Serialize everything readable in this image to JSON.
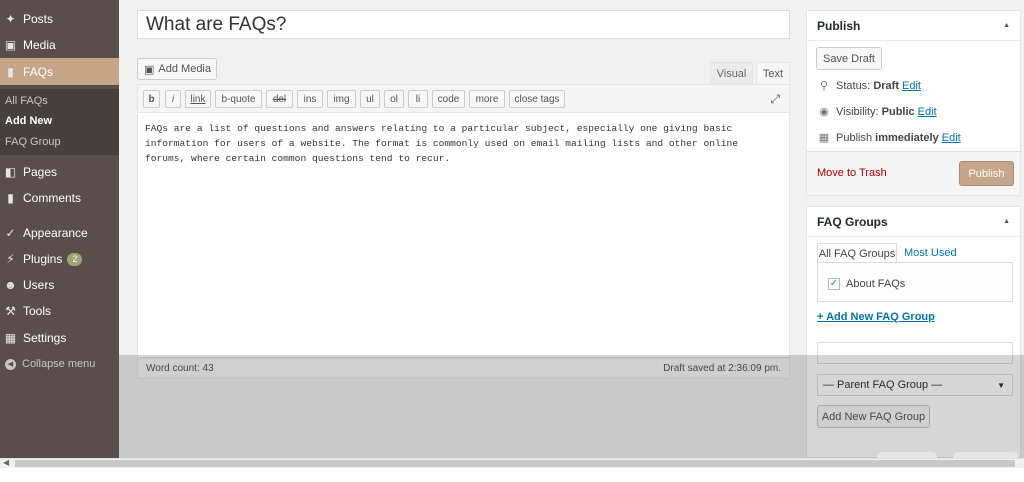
{
  "menu": {
    "posts": "Posts",
    "media": "Media",
    "faqs": "FAQs",
    "submenu": [
      "All FAQs",
      "Add New",
      "FAQ Group"
    ],
    "pages": "Pages",
    "comments": "Comments",
    "appearance": "Appearance",
    "plugins": "Plugins",
    "plugins_badge": "2",
    "users": "Users",
    "tools": "Tools",
    "settings": "Settings",
    "collapse": "Collapse menu"
  },
  "post": {
    "title": "What are FAQs?",
    "add_media": "Add Media",
    "tab_visual": "Visual",
    "tab_text": "Text",
    "quicktags": [
      "b",
      "i",
      "link",
      "b-quote",
      "del",
      "ins",
      "img",
      "ul",
      "ol",
      "li",
      "code",
      "more",
      "close tags"
    ],
    "content": "FAQs are a list of questions and answers relating to a particular subject, especially one giving basic information for users of a website. The format is commonly used on email mailing lists and other online forums, where certain common questions tend to recur.",
    "word_count": "Word count: 43",
    "draft_saved": "Draft saved at 2:36:09 pm."
  },
  "publish": {
    "heading": "Publish",
    "save_draft": "Save Draft",
    "status_label": "Status:",
    "status_value": "Draft",
    "visibility_label": "Visibility:",
    "visibility_value": "Public",
    "publish_label": "Publish",
    "publish_value": "immediately",
    "edit": "Edit",
    "trash": "Move to Trash",
    "publish_button": "Publish"
  },
  "faq_groups": {
    "heading": "FAQ Groups",
    "tab_all": "All FAQ Groups",
    "tab_used": "Most Used",
    "group_item": "About FAQs",
    "add_new_link": "+ Add New FAQ Group",
    "parent_select": "— Parent FAQ Group —",
    "add_button": "Add New FAQ Group"
  },
  "colors": {
    "menu_bg": "#584f4b",
    "menu_current": "#c7a589",
    "link": "#0073aa",
    "trash": "#a00"
  }
}
